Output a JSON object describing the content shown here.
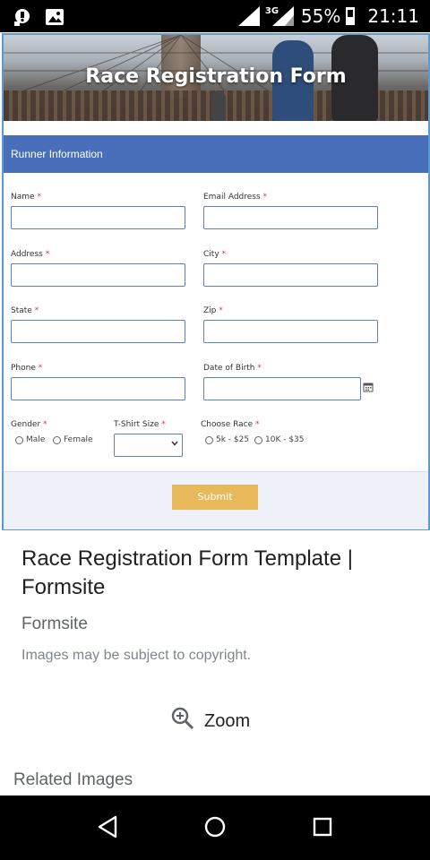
{
  "status": {
    "signal_tag": "3G",
    "battery": "55%",
    "time": "21:11",
    "icons": [
      "notification-icon",
      "image-icon",
      "signal-icon",
      "battery-icon"
    ]
  },
  "form": {
    "banner_title": "Race Registration Form",
    "section_title": "Runner Information",
    "required_mark": "*",
    "fields": {
      "name": "Name",
      "email": "Email Address",
      "address": "Address",
      "city": "City",
      "state": "State",
      "zip": "Zip",
      "phone": "Phone",
      "dob": "Date of Birth",
      "gender": "Gender",
      "tshirt": "T-Shirt Size",
      "race": "Choose Race"
    },
    "gender_options": [
      "Male",
      "Female"
    ],
    "race_options": [
      "5k - $25",
      "10K - $35"
    ],
    "tshirt_selected": "",
    "submit_label": "Submit",
    "accent_color": "#4a6fba",
    "submit_color": "#e8b95a"
  },
  "result": {
    "title": "Race Registration Form Template | Formsite",
    "source": "Formsite",
    "copyright": "Images may be subject to copyright.",
    "zoom_label": "Zoom",
    "related_label": "Related Images"
  },
  "navbar": {
    "icons": [
      "back-icon",
      "home-icon",
      "recents-icon"
    ]
  }
}
